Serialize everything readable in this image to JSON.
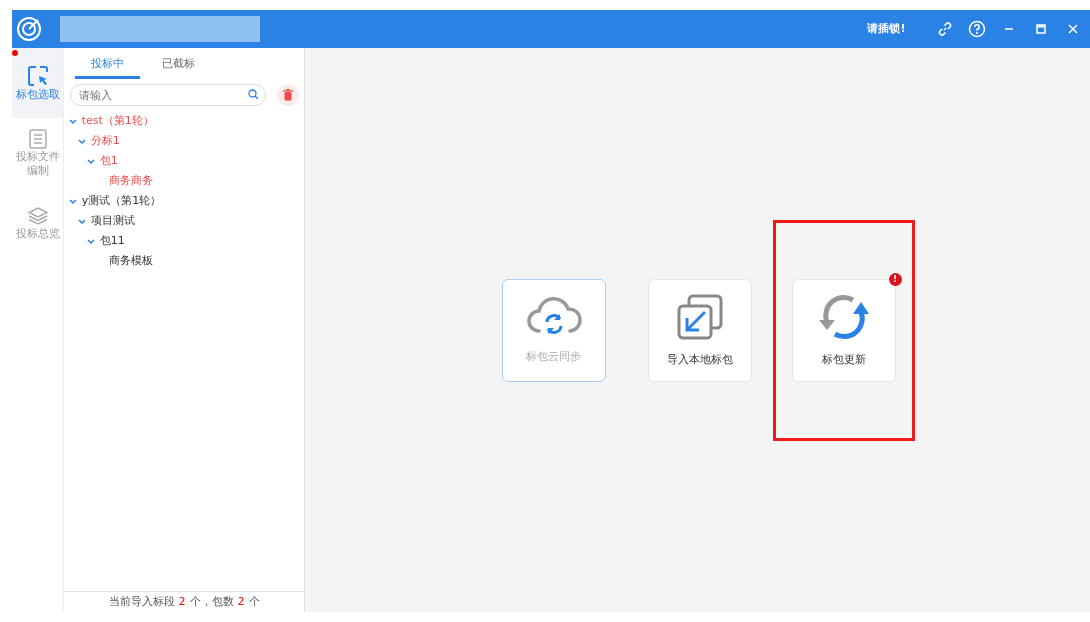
{
  "titlebar": {
    "notice": "请插锁!"
  },
  "nav": [
    {
      "label": "标包选取",
      "selected": true,
      "alert": true,
      "kind": "select"
    },
    {
      "label": "投标文件编制",
      "selected": false,
      "alert": false,
      "kind": "document"
    },
    {
      "label": "投标总览",
      "selected": false,
      "alert": false,
      "kind": "layers"
    }
  ],
  "tabs": [
    {
      "label": "投标中",
      "selected": true
    },
    {
      "label": "已截标",
      "selected": false
    }
  ],
  "search": {
    "placeholder": "请输入"
  },
  "tree": [
    {
      "label": "test（第1轮）",
      "selected": true,
      "expanded": true,
      "children": [
        {
          "label": "分标1",
          "selected": true,
          "expanded": true,
          "children": [
            {
              "label": "包1",
              "selected": true,
              "expanded": true,
              "children": [
                {
                  "label": "商务商务",
                  "selected": true
                }
              ]
            }
          ]
        }
      ]
    },
    {
      "label": "y测试（第1轮）",
      "selected": false,
      "expanded": true,
      "children": [
        {
          "label": "项目测试",
          "selected": false,
          "expanded": true,
          "children": [
            {
              "label": "包11",
              "selected": false,
              "expanded": true,
              "children": [
                {
                  "label": "商务模板",
                  "selected": false
                }
              ]
            }
          ]
        }
      ]
    }
  ],
  "footer": {
    "prefix": "当前导入标段",
    "sections": "2",
    "middle": "个，包数",
    "packages": "2",
    "suffix": "个"
  },
  "actions": [
    {
      "label": "标包云同步",
      "kind": "cloud",
      "disabled": true,
      "highlighted": false
    },
    {
      "label": "导入本地标包",
      "kind": "import",
      "disabled": false,
      "highlighted": false
    },
    {
      "label": "标包更新",
      "kind": "update",
      "disabled": false,
      "badge": "!",
      "highlighted": true
    }
  ]
}
